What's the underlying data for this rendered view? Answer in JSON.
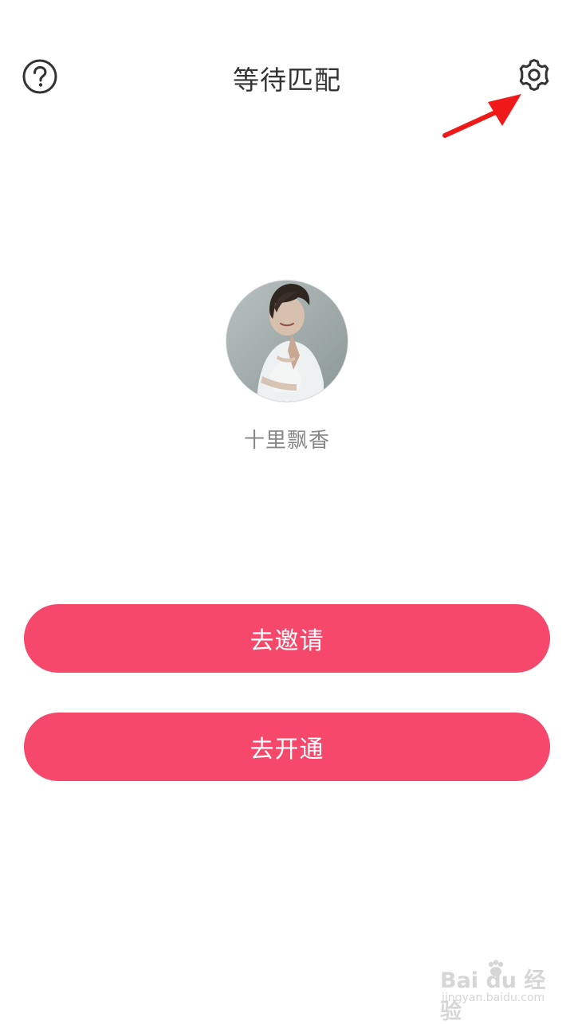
{
  "header": {
    "title": "等待匹配",
    "help_icon": "question-circle-icon",
    "settings_icon": "gear-icon"
  },
  "annotation": {
    "arrow_color": "#f01919"
  },
  "profile": {
    "username": "十里飘香"
  },
  "buttons": {
    "invite_label": "去邀请",
    "activate_label": "去开通",
    "color": "#f6486b"
  },
  "watermark": {
    "brand": "Bai du 经验",
    "url": "jingyan.baidu.com"
  }
}
